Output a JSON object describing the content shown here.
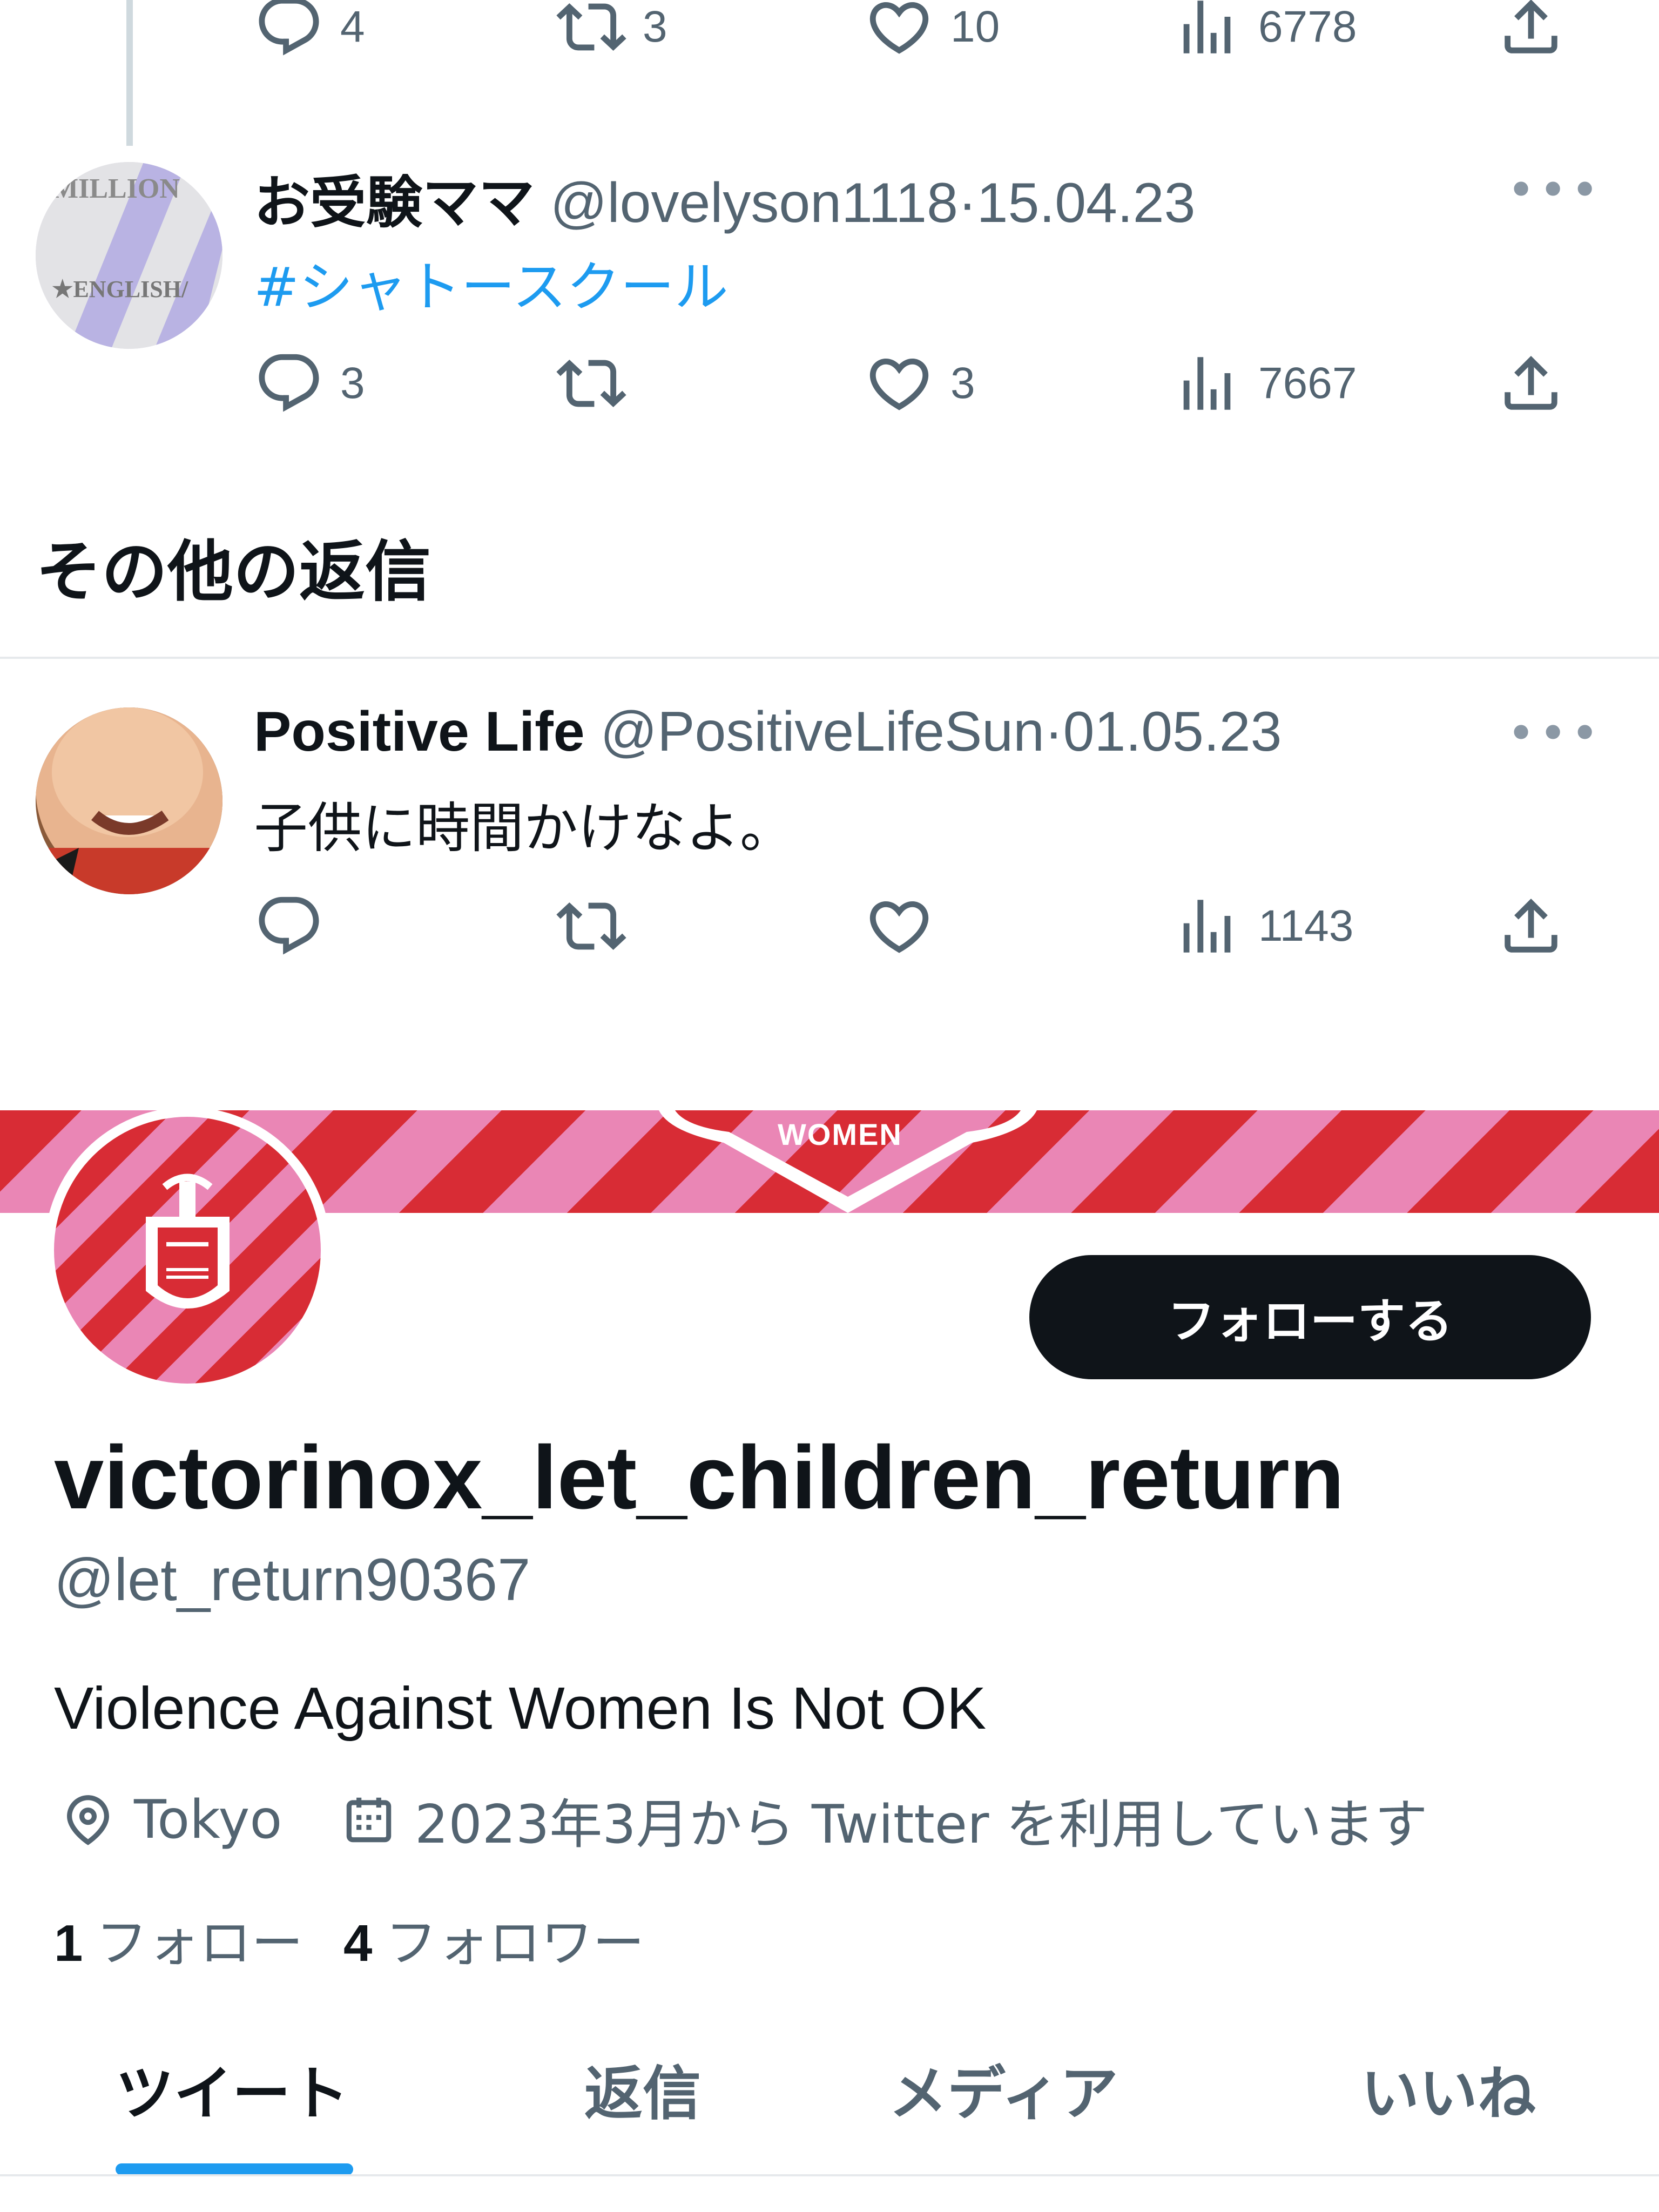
{
  "tweet1": {
    "actions": {
      "reply": "4",
      "retweet": "3",
      "like": "10",
      "views": "6778"
    }
  },
  "tweet2": {
    "name": "お受験ママ",
    "handle": "@lovelyson1118",
    "date": "15.04.23",
    "separator": "·",
    "text": "#シャトースクール",
    "avatar_text_top": "MILLION",
    "avatar_text_bottom": "★ENGLISH/",
    "actions": {
      "reply": "3",
      "retweet": "",
      "like": "3",
      "views": "7667"
    }
  },
  "section_title": "その他の返信",
  "tweet3": {
    "name": "Positive Life",
    "handle": "@PositiveLifeSun",
    "date": "01.05.23",
    "separator": "·",
    "text": "子供に時間かけなよ。",
    "actions": {
      "reply": "",
      "retweet": "",
      "like": "",
      "views": "1143"
    }
  },
  "profile": {
    "banner_text": "WOMEN",
    "follow_button": "フォローする",
    "display_name": "victorinox_let_children_return",
    "handle": "@let_return90367",
    "bio": "Violence Against Women Is Not OK",
    "location": "Tokyo",
    "joined": "2023年3月から Twitter を利用しています",
    "following_count": "1",
    "following_label": "フォロー",
    "followers_count": "4",
    "followers_label": "フォロワー"
  },
  "tabs": [
    "ツイート",
    "返信",
    "メディア",
    "いいね"
  ],
  "colors": {
    "accent": "#1d9bf0",
    "text": "#0f1419",
    "secondary": "#536471",
    "banner_red": "#d82c35",
    "banner_pink": "#ea86b5"
  }
}
